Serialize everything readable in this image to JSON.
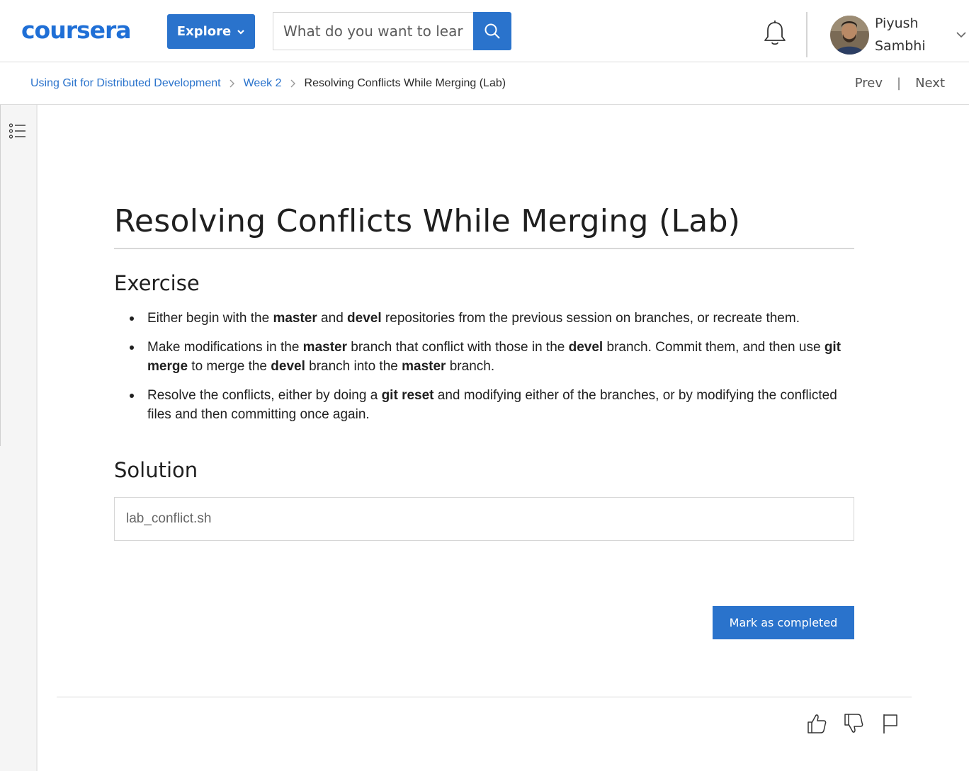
{
  "header": {
    "logo_text": "coursera",
    "explore_label": "Explore",
    "search_placeholder": "What do you want to learn?",
    "user_first_name": "Piyush",
    "user_last_name": "Sambhi",
    "brand_color": "#2a73cc"
  },
  "breadcrumb": {
    "items": [
      {
        "label": "Using Git for Distributed Development"
      },
      {
        "label": "Week 2"
      },
      {
        "label": "Resolving Conflicts While Merging (Lab)"
      }
    ],
    "prev_label": "Prev",
    "separator": "|",
    "next_label": "Next"
  },
  "content": {
    "title": "Resolving Conflicts While Merging (Lab)",
    "exercise_heading": "Exercise",
    "exercise_items": [
      [
        {
          "t": "Either begin with the ",
          "b": false
        },
        {
          "t": "master",
          "b": true
        },
        {
          "t": " and ",
          "b": false
        },
        {
          "t": "devel",
          "b": true
        },
        {
          "t": " repositories from the previous session on branches, or recreate them.",
          "b": false
        }
      ],
      [
        {
          "t": "Make modifications in the ",
          "b": false
        },
        {
          "t": "master",
          "b": true
        },
        {
          "t": " branch that conflict with those in the ",
          "b": false
        },
        {
          "t": "devel",
          "b": true
        },
        {
          "t": " branch. Commit them, and then use ",
          "b": false
        },
        {
          "t": "git merge",
          "b": true
        },
        {
          "t": " to merge the ",
          "b": false
        },
        {
          "t": "devel",
          "b": true
        },
        {
          "t": " branch into the ",
          "b": false
        },
        {
          "t": "master",
          "b": true
        },
        {
          "t": " branch.",
          "b": false
        }
      ],
      [
        {
          "t": "Resolve the conflicts, either by doing a ",
          "b": false
        },
        {
          "t": "git reset",
          "b": true
        },
        {
          "t": " and modifying either of the branches, or by modifying the conflicted files and then committing once again.",
          "b": false
        }
      ]
    ],
    "solution_heading": "Solution",
    "solution_file": "lab_conflict.sh",
    "mark_completed_label": "Mark as completed"
  },
  "icons": {
    "search": "search-icon",
    "notifications": "bell-icon",
    "outline": "list-icon",
    "like": "thumbs-up-icon",
    "dislike": "thumbs-down-icon",
    "report": "flag-icon"
  }
}
